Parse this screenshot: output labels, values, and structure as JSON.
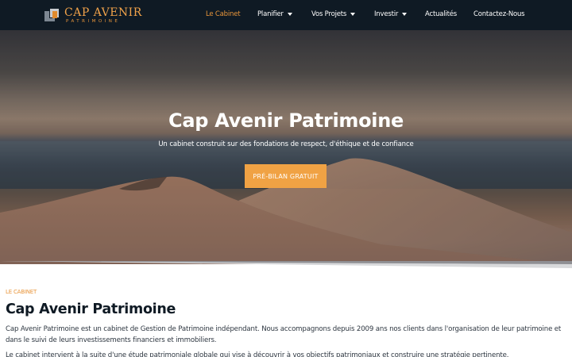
{
  "brand": {
    "name": "CAP AVENIR",
    "tagline": "PATRIMOINE"
  },
  "nav": {
    "items": [
      {
        "label": "Le Cabinet",
        "active": true,
        "dropdown": false
      },
      {
        "label": "Planifier",
        "active": false,
        "dropdown": true
      },
      {
        "label": "Vos Projets",
        "active": false,
        "dropdown": true
      },
      {
        "label": "Investir",
        "active": false,
        "dropdown": true
      },
      {
        "label": "Actualités",
        "active": false,
        "dropdown": false
      },
      {
        "label": "Contactez-Nous",
        "active": false,
        "dropdown": false
      }
    ]
  },
  "hero": {
    "title": "Cap Avenir Patrimoine",
    "subtitle": "Un cabinet construit sur des fondations de respect, d'éthique et de confiance",
    "cta_label": "PRÉ-BILAN GRATUIT"
  },
  "content": {
    "section_label": "LE CABINET",
    "title": "Cap Avenir Patrimoine",
    "paragraph_1": "Cap Avenir Patrimoine est un cabinet de Gestion de Patrimoine indépendant.  Nous accompagnons depuis 2009 ans nos clients dans l'organisation de leur patrimoine et dans le suivi de leurs investissements financiers et immobiliers.",
    "paragraph_2": "Le cabinet intervient à la suite d'une étude patrimoniale globale qui vise à découvrir à vos objectifs patrimoniaux et construire une stratégie pertinente."
  },
  "colors": {
    "header_bg": "#0f1a24",
    "accent": "#e8953a",
    "cta_bg": "#f0a244",
    "text_dark": "#0f1a24"
  },
  "icons": {
    "logo": "cap-avenir-logo-icon",
    "dropdown": "chevron-down-icon"
  }
}
